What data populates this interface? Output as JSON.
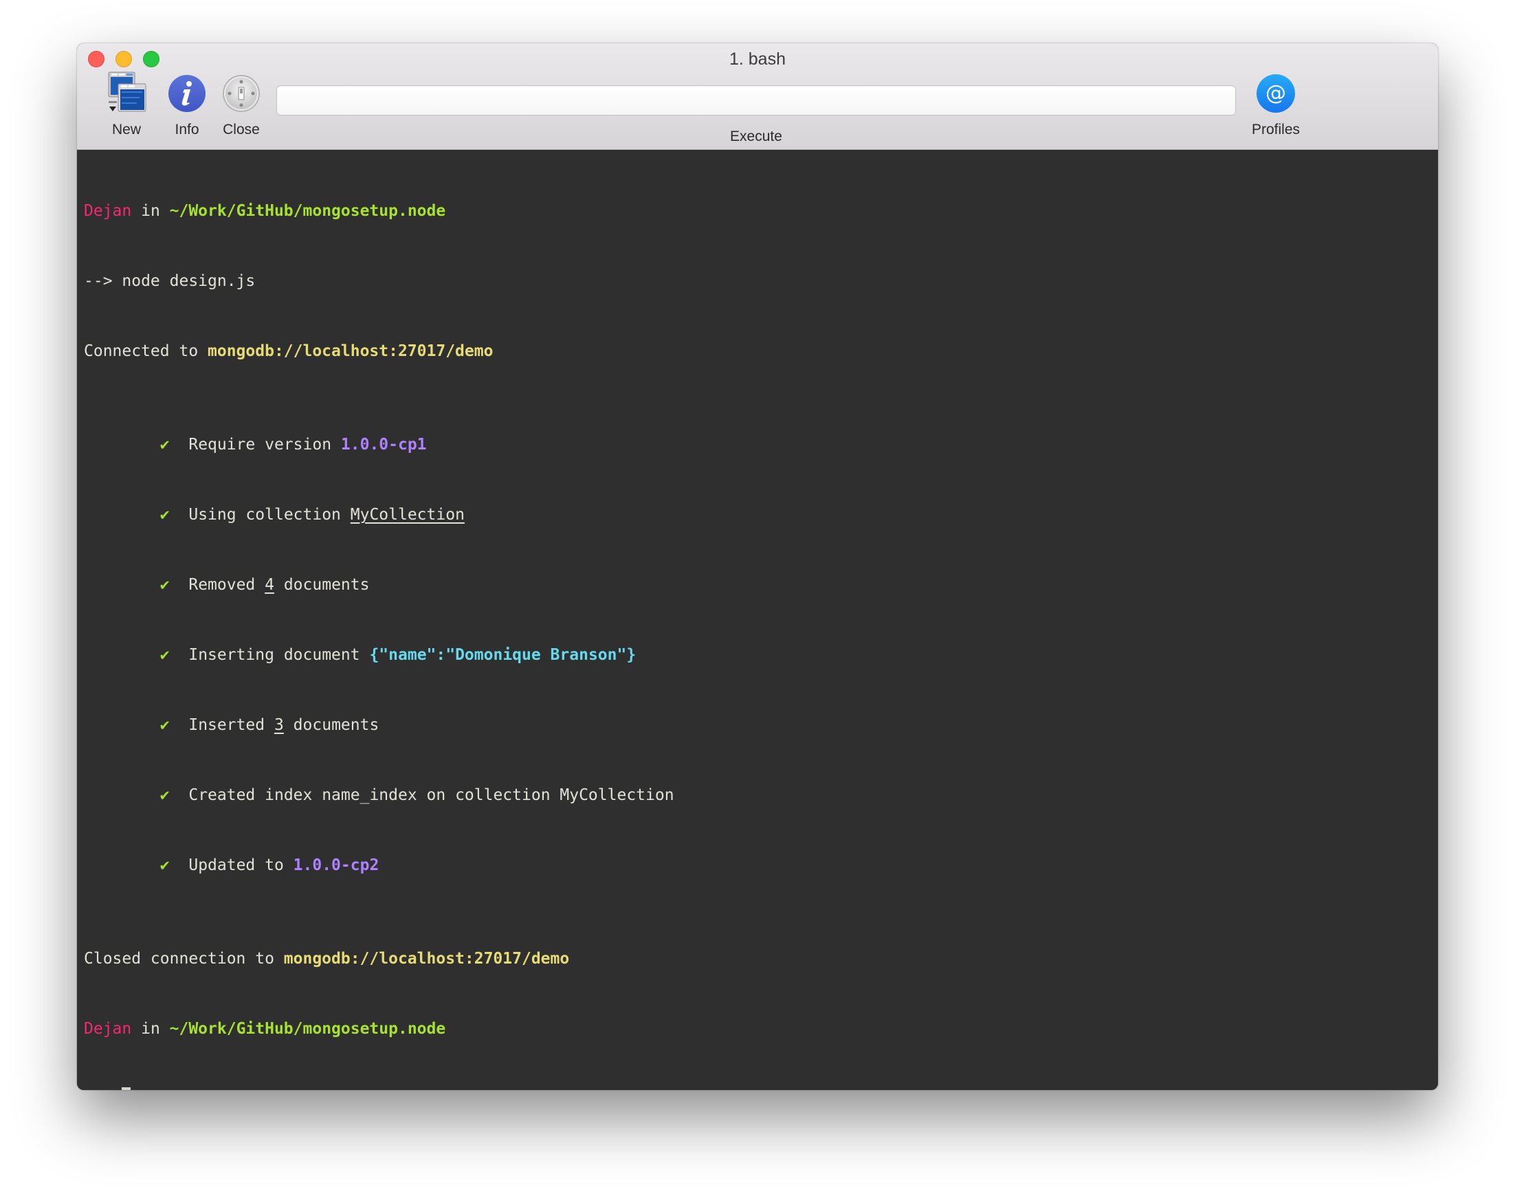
{
  "window": {
    "title": "1. bash"
  },
  "toolbar": {
    "new_label": "New",
    "info_label": "Info",
    "close_label": "Close",
    "execute_label": "Execute",
    "execute_value": "",
    "execute_placeholder": "",
    "profiles_label": "Profiles",
    "icons": {
      "new": "new-window-icon",
      "info": "info-icon",
      "close": "close-switch-icon",
      "profiles": "at-sign-icon"
    }
  },
  "colors": {
    "background": "#2f2f2f",
    "text": "#e2e2d8",
    "user": "#f92672",
    "path": "#a6e22e",
    "url": "#e6db74",
    "version": "#ae81ff",
    "json": "#66d9ef",
    "check": "#a6e22e"
  },
  "terminal": {
    "prompt1": {
      "user": "Dejan",
      "in": " in ",
      "path": "~/Work/GitHub/mongosetup.node"
    },
    "command": {
      "prompt": "--> ",
      "text": "node design.js"
    },
    "connected": {
      "text": "Connected to ",
      "url": "mongodb://localhost:27017/demo"
    },
    "steps": [
      {
        "check": "✔",
        "text": "Require version ",
        "highlight": "1.0.0-cp1",
        "after": ""
      },
      {
        "check": "✔",
        "text": "Using collection ",
        "highlight": "MyCollection",
        "after": ""
      },
      {
        "check": "✔",
        "text": "Removed ",
        "highlight": "4",
        "after": " documents"
      },
      {
        "check": "✔",
        "text": "Inserting document ",
        "highlight": "{\"name\":\"Domonique Branson\"}",
        "after": ""
      },
      {
        "check": "✔",
        "text": "Inserted ",
        "highlight": "3",
        "after": " documents"
      },
      {
        "check": "✔",
        "text": "Created index name_index on collection MyCollection",
        "highlight": "",
        "after": ""
      },
      {
        "check": "✔",
        "text": "Updated to ",
        "highlight": "1.0.0-cp2",
        "after": ""
      }
    ],
    "closed": {
      "text": "Closed connection to ",
      "url": "mongodb://localhost:27017/demo"
    },
    "prompt2": {
      "user": "Dejan",
      "in": " in ",
      "path": "~/Work/GitHub/mongosetup.node"
    },
    "current": {
      "prompt": "--> ",
      "input": ""
    }
  }
}
